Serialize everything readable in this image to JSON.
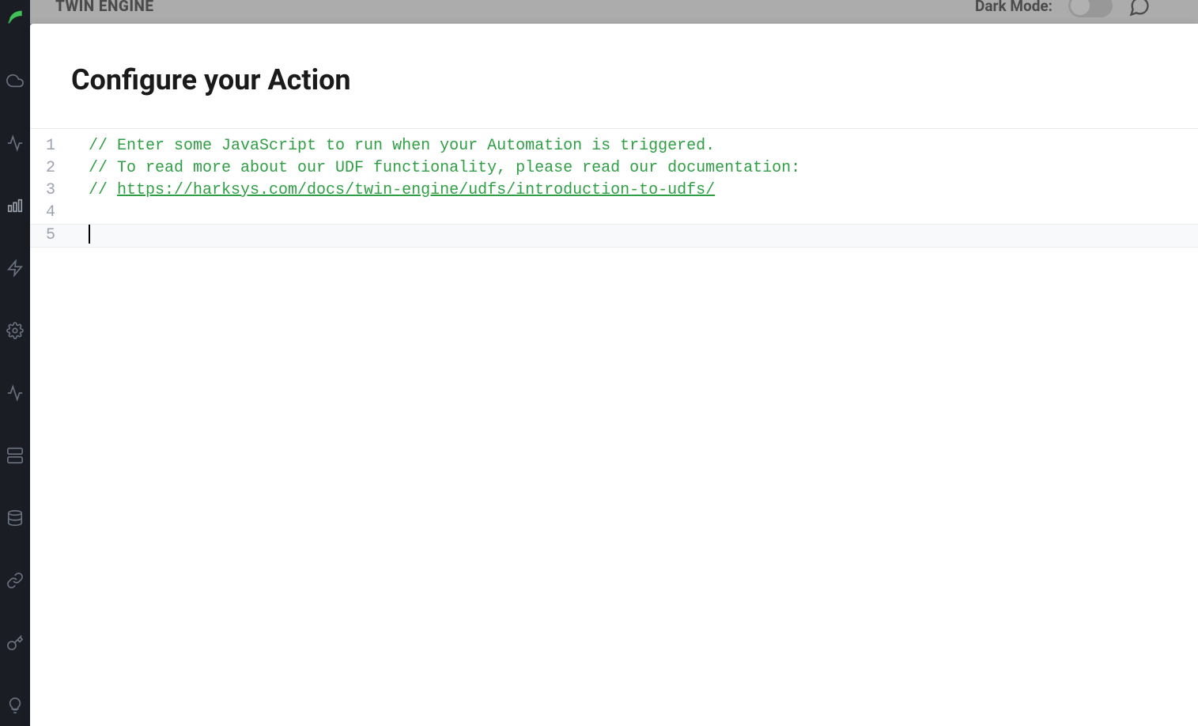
{
  "header": {
    "app_title": "TWIN ENGINE",
    "dark_mode_label": "Dark Mode:"
  },
  "sidebar": {
    "logo_name": "leaf-logo",
    "items": [
      {
        "icon": "cloud-icon"
      },
      {
        "icon": "activity-icon"
      },
      {
        "icon": "bar-chart-icon"
      },
      {
        "icon": "bolt-icon"
      },
      {
        "icon": "gear-icon"
      },
      {
        "icon": "pulse-icon"
      },
      {
        "icon": "server-icon"
      },
      {
        "icon": "database-icon"
      },
      {
        "icon": "link-icon"
      },
      {
        "icon": "key-icon"
      },
      {
        "icon": "bulb-icon"
      }
    ]
  },
  "modal": {
    "title": "Configure your Action"
  },
  "editor": {
    "lines": [
      {
        "num": "1",
        "type": "comment",
        "text": "// Enter some JavaScript to run when your Automation is triggered."
      },
      {
        "num": "2",
        "type": "comment",
        "text": "// To read more about our UDF functionality, please read our documentation:"
      },
      {
        "num": "3",
        "type": "comment-link",
        "prefix": "// ",
        "link": "https://harksys.com/docs/twin-engine/udfs/introduction-to-udfs/"
      },
      {
        "num": "4",
        "type": "empty",
        "text": ""
      },
      {
        "num": "5",
        "type": "cursor",
        "text": ""
      }
    ]
  }
}
